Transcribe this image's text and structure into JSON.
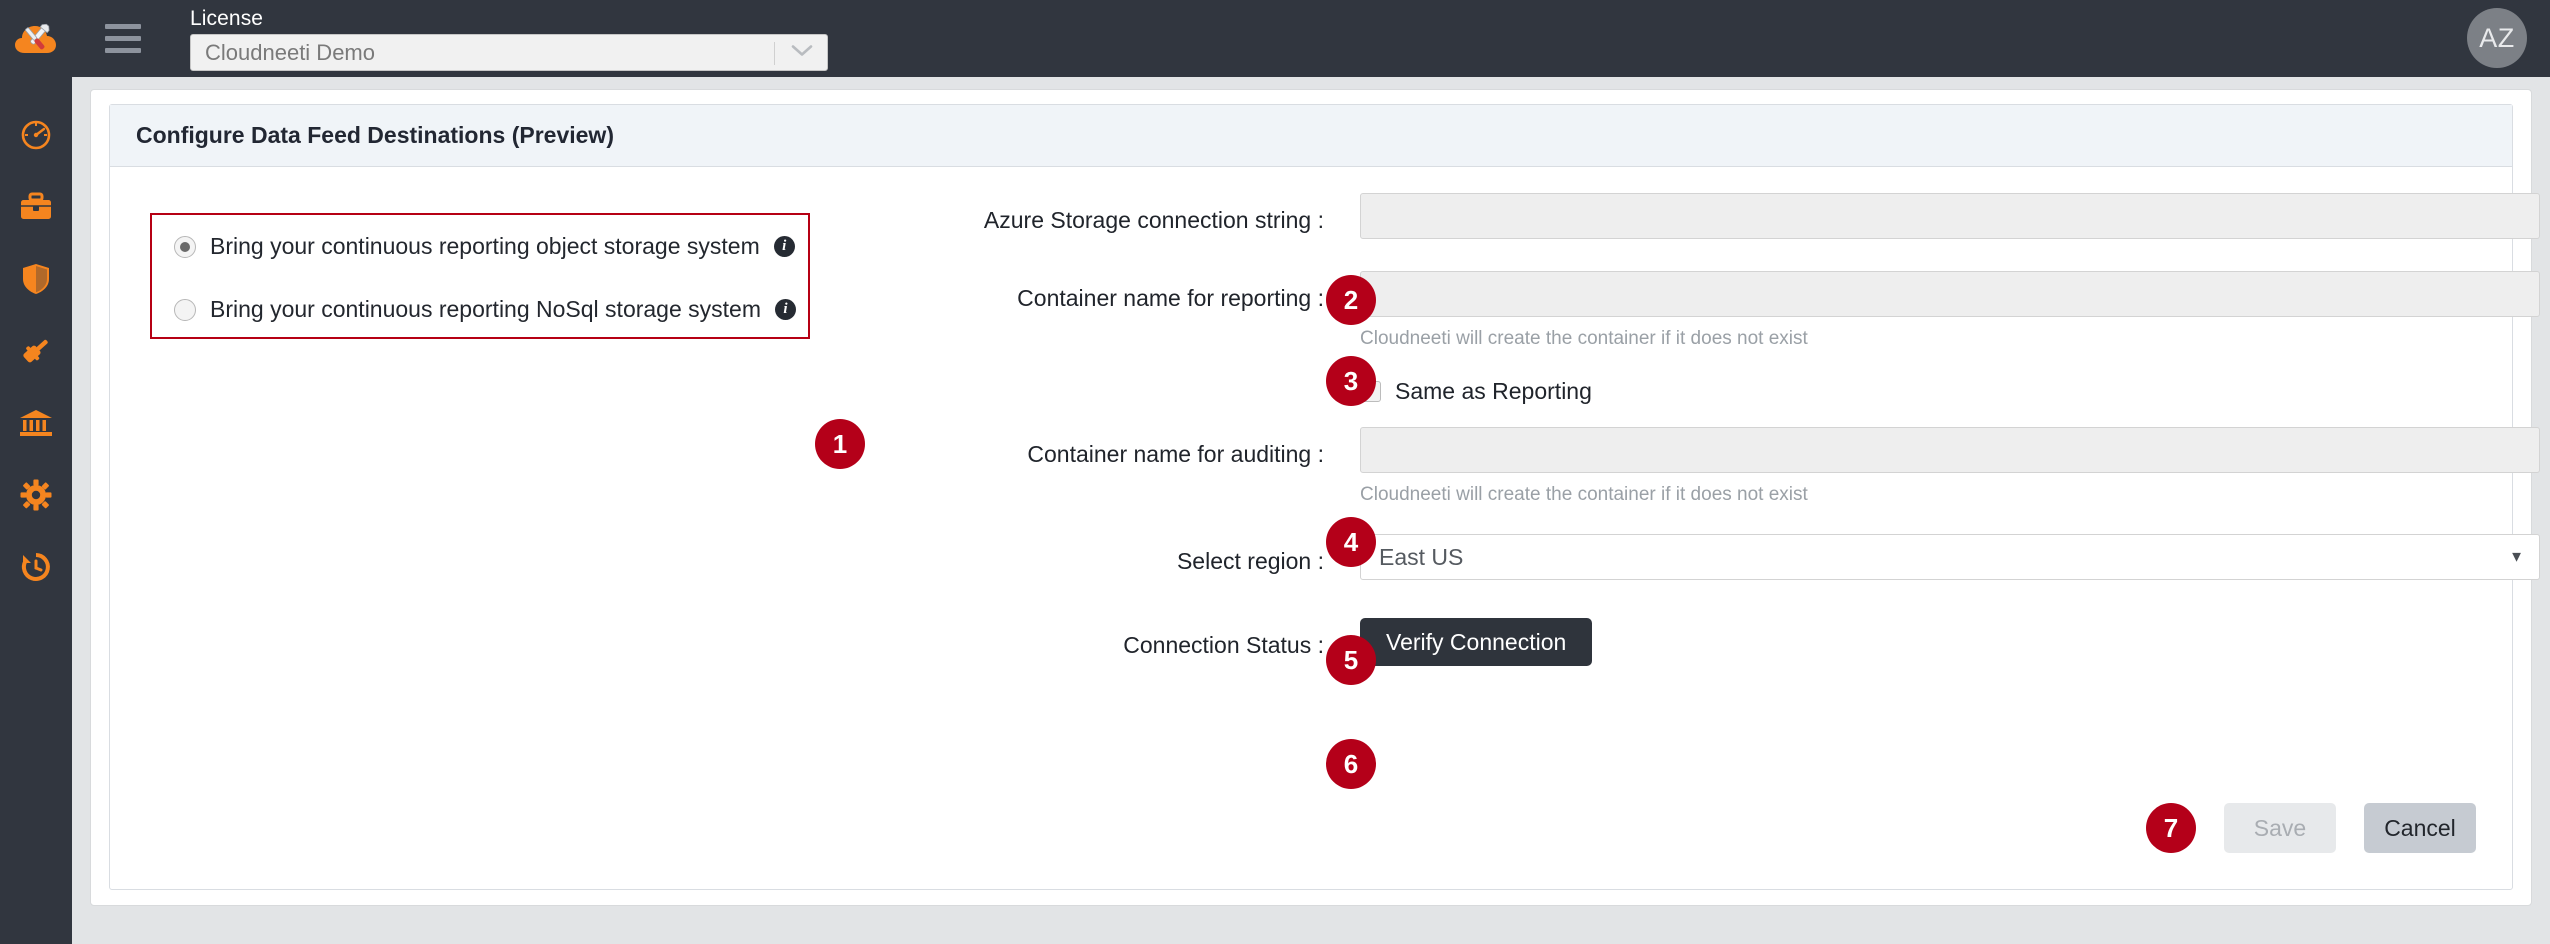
{
  "header": {
    "logo_icon": "cloud-tools-logo",
    "menu_icon": "hamburger-menu-icon",
    "license_label": "License",
    "license_value": "Cloudneeti Demo",
    "license_caret_icon": "chevron-down-icon",
    "avatar_initials": "AZ"
  },
  "sidebar": {
    "items": [
      {
        "name": "dashboard",
        "icon": "gauge-icon"
      },
      {
        "name": "portfolio",
        "icon": "briefcase-icon"
      },
      {
        "name": "security",
        "icon": "shield-icon"
      },
      {
        "name": "compliance",
        "icon": "gavel-icon"
      },
      {
        "name": "governance",
        "icon": "bank-icon"
      },
      {
        "name": "settings",
        "icon": "gear-icon"
      },
      {
        "name": "history",
        "icon": "history-icon"
      }
    ]
  },
  "card": {
    "title": "Configure Data Feed Destinations (Preview)"
  },
  "storage_options": {
    "badge": "1",
    "options": [
      {
        "label": "Bring your continuous reporting object storage system",
        "selected": true,
        "info_icon": "info-icon"
      },
      {
        "label": "Bring your continuous reporting NoSql storage system",
        "selected": false,
        "info_icon": "info-icon"
      }
    ]
  },
  "form": {
    "connection_string": {
      "badge": "2",
      "label": "Azure Storage connection string :",
      "value": "",
      "placeholder": ""
    },
    "container_reporting": {
      "badge": "3",
      "label": "Container name for reporting :",
      "value": "",
      "placeholder": "",
      "hint": "Cloudneeti will create the container if it does not exist"
    },
    "same_as_reporting": {
      "label": "Same as Reporting",
      "checked": false
    },
    "container_auditing": {
      "badge": "4",
      "label": "Container name for auditing :",
      "value": "",
      "placeholder": "",
      "hint": "Cloudneeti will create the container if it does not exist"
    },
    "region": {
      "badge": "5",
      "label": "Select region :",
      "value": "East US",
      "caret_icon": "caret-down-icon"
    },
    "connection_status": {
      "badge": "6",
      "label": "Connection Status :",
      "button_label": "Verify Connection"
    }
  },
  "footer": {
    "badge": "7",
    "save_label": "Save",
    "cancel_label": "Cancel"
  },
  "colors": {
    "accent_red": "#b40019",
    "brand_orange": "#f5851f",
    "dark_nav": "#31363f"
  }
}
